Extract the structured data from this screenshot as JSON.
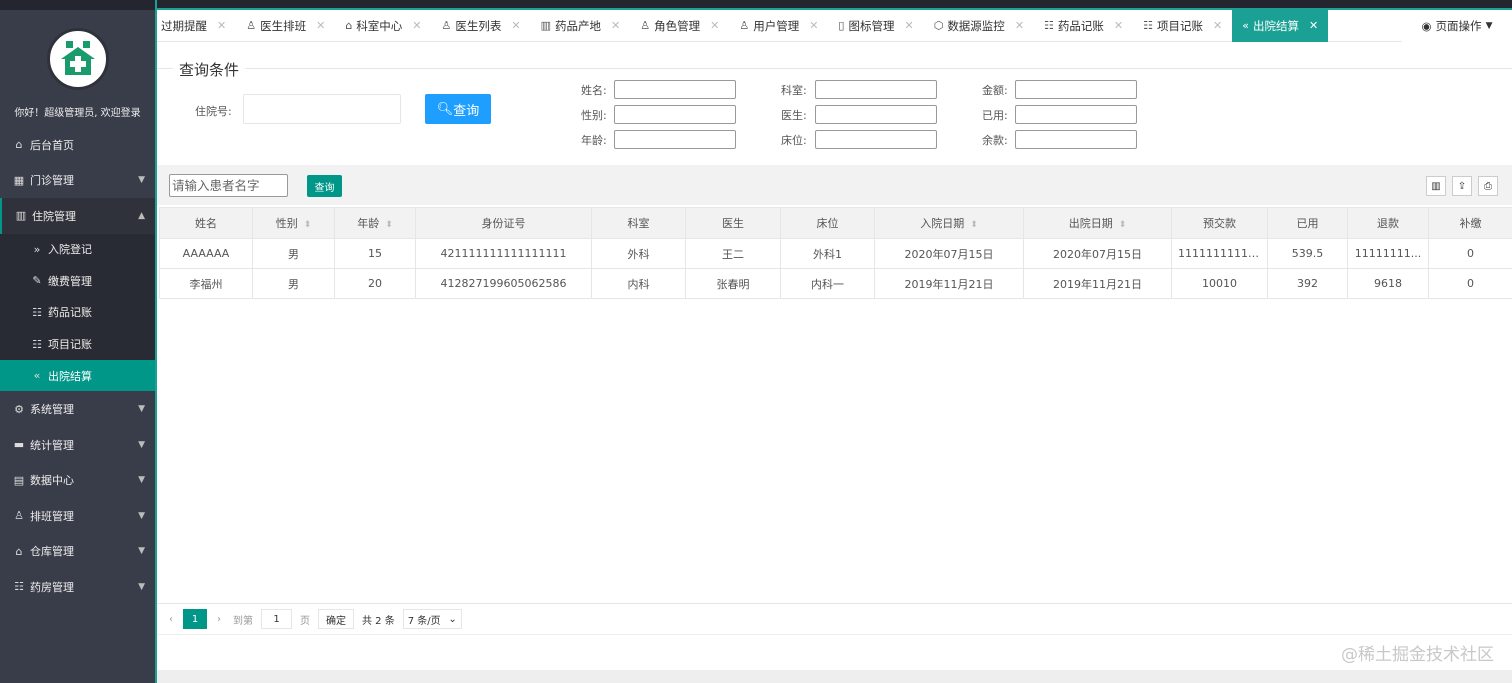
{
  "sidebar": {
    "welcome": "你好！超级管理员, 欢迎登录",
    "items": [
      {
        "label": "后台首页"
      },
      {
        "label": "门诊管理"
      },
      {
        "label": "住院管理"
      }
    ],
    "sub_items": [
      {
        "label": "入院登记"
      },
      {
        "label": "缴费管理"
      },
      {
        "label": "药品记账"
      },
      {
        "label": "项目记账"
      },
      {
        "label": "出院结算"
      }
    ],
    "items2": [
      {
        "label": "系统管理"
      },
      {
        "label": "统计管理"
      },
      {
        "label": "数据中心"
      },
      {
        "label": "排班管理"
      },
      {
        "label": "仓库管理"
      },
      {
        "label": "药房管理"
      }
    ]
  },
  "tabs": [
    {
      "label": "过期提醒"
    },
    {
      "label": "医生排班"
    },
    {
      "label": "科室中心"
    },
    {
      "label": "医生列表"
    },
    {
      "label": "药品产地"
    },
    {
      "label": "角色管理"
    },
    {
      "label": "用户管理"
    },
    {
      "label": "图标管理"
    },
    {
      "label": "数据源监控"
    },
    {
      "label": "药品记账"
    },
    {
      "label": "项目记账"
    },
    {
      "label": "出院结算"
    }
  ],
  "page_ops": "页面操作",
  "query": {
    "legend": "查询条件",
    "inpatient_no_label": "住院号:",
    "search_button": "查询",
    "fields": {
      "name": "姓名:",
      "gender": "性别:",
      "age": "年龄:",
      "dept": "科室:",
      "doctor": "医生:",
      "bed": "床位:",
      "amount": "金额:",
      "used": "已用:",
      "balance": "余款:"
    }
  },
  "toolbar": {
    "search_placeholder": "请输入患者名字",
    "search_button": "查询"
  },
  "table": {
    "columns": [
      "姓名",
      "性别",
      "年龄",
      "身份证号",
      "科室",
      "医生",
      "床位",
      "入院日期",
      "出院日期",
      "预交款",
      "已用",
      "退款",
      "补缴"
    ],
    "rows": [
      [
        "AAAAAA",
        "男",
        "15",
        "421111111111111111",
        "外科",
        "王二",
        "外科1",
        "2020年07月15日",
        "2020年07月15日",
        "11111111111...",
        "539.5",
        "11111111...",
        "0"
      ],
      [
        "李福州",
        "男",
        "20",
        "412827199605062586",
        "内科",
        "张春明",
        "内科一",
        "2019年11月21日",
        "2019年11月21日",
        "10010",
        "392",
        "9618",
        "0"
      ]
    ]
  },
  "pager": {
    "current": "1",
    "goto_label": "到第",
    "goto_value": "1",
    "page_label": "页",
    "confirm": "确定",
    "total": "共 2 条",
    "per_page": "7 条/页"
  },
  "watermark": "@稀土掘金技术社区"
}
